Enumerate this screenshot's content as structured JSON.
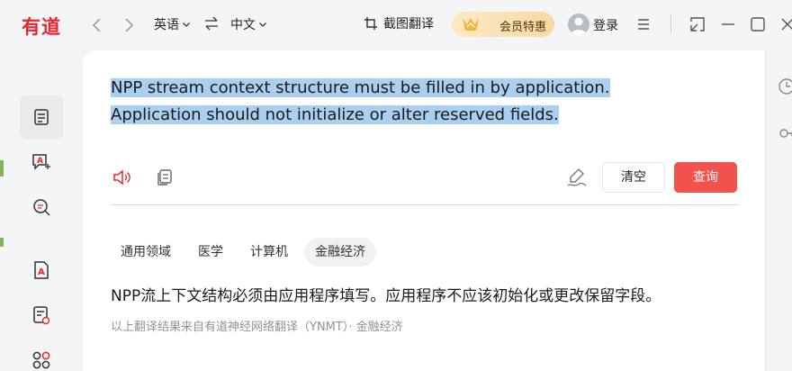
{
  "app": {
    "logo": "有道"
  },
  "titlebar": {
    "source_lang": "英语",
    "target_lang": "中文",
    "screenshot_translate": "截图翻译",
    "vip_label": "会员特惠",
    "login": "登录"
  },
  "main": {
    "source_text": "NPP stream context structure must be filled in by application. Application should not initialize or alter reserved fields.",
    "clear_label": "清空",
    "query_label": "查询",
    "domains": [
      "通用领域",
      "医学",
      "计算机",
      "金融经济"
    ],
    "active_domain": "金融经济",
    "result_text": "NPP流上下文结构必须由应用程序填写。应用程序不应该初始化或更改保留字段。",
    "credit_text": "以上翻译结果来自有道神经网络翻译（YNMT）· 金融经济"
  },
  "colors": {
    "brand": "#e8262d",
    "accent": "#f2514d",
    "selection": "#a9cff1"
  }
}
